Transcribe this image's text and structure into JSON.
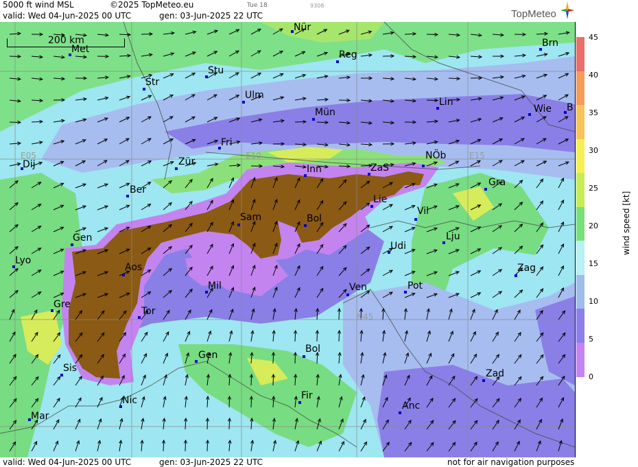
{
  "header": {
    "product": "5000 ft wind MSL",
    "copyright": "©2025 TopMeteo.eu",
    "small_day": "Tue 18",
    "small_code": "9308",
    "valid_line": "valid:  Wed  04-Jun-2025  00 UTC",
    "gen_line": "gen: 03-Jun-2025 22 UTC"
  },
  "logo": {
    "text": "TopMeteo"
  },
  "scale": {
    "label": "200 km"
  },
  "grid_labels": [
    "E05",
    "E10",
    "E15",
    "N45"
  ],
  "cities": [
    {
      "name": "Nür"
    },
    {
      "name": "Met"
    },
    {
      "name": "Reg"
    },
    {
      "name": "Brn"
    },
    {
      "name": "Stu"
    },
    {
      "name": "Str"
    },
    {
      "name": "Ulm"
    },
    {
      "name": "Mün"
    },
    {
      "name": "Lin"
    },
    {
      "name": "Wie"
    },
    {
      "name": "B"
    },
    {
      "name": "Fri"
    },
    {
      "name": "Dij"
    },
    {
      "name": "Zür"
    },
    {
      "name": "Inn"
    },
    {
      "name": "ZaS"
    },
    {
      "name": "NÖb"
    },
    {
      "name": "Gra"
    },
    {
      "name": "Ber"
    },
    {
      "name": "Lie"
    },
    {
      "name": "Sam"
    },
    {
      "name": "Bol"
    },
    {
      "name": "Vil"
    },
    {
      "name": "Gen"
    },
    {
      "name": "Lju"
    },
    {
      "name": "Lyo"
    },
    {
      "name": "Udi"
    },
    {
      "name": "Aos"
    },
    {
      "name": "Zag"
    },
    {
      "name": "Mil"
    },
    {
      "name": "Ven"
    },
    {
      "name": "Pot"
    },
    {
      "name": "Gre"
    },
    {
      "name": "Tor"
    },
    {
      "name": "Gen"
    },
    {
      "name": "Bol"
    },
    {
      "name": "Sis"
    },
    {
      "name": "Zad"
    },
    {
      "name": "Nic"
    },
    {
      "name": "Fir"
    },
    {
      "name": "Anc"
    },
    {
      "name": "Mar"
    }
  ],
  "legend": {
    "title": "wind speed [kt]",
    "ticks": [
      "45",
      "40",
      "35",
      "30",
      "25",
      "20",
      "15",
      "10",
      "5",
      "0"
    ],
    "colors": [
      "#e8706a",
      "#f29d5a",
      "#f6c45a",
      "#f7ee54",
      "#c6ec5a",
      "#78e07a",
      "#b8f0f4",
      "#9ebde8",
      "#8c80e6",
      "#c384f0"
    ]
  },
  "footer": {
    "valid_line": "valid:  Wed  04-Jun-2025  00 UTC",
    "gen_line": "gen: 03-Jun-2025 22 UTC",
    "disclaimer": "not for air navigation purposes"
  },
  "colors": {
    "calm": "#c38ef0",
    "light": "#8a7fe6",
    "moderate": "#a7bdf0",
    "fresh": "#a4ecf4",
    "strong": "#78dc82",
    "very_strong": "#c2ea5a",
    "terrain": "#8b5a14"
  }
}
